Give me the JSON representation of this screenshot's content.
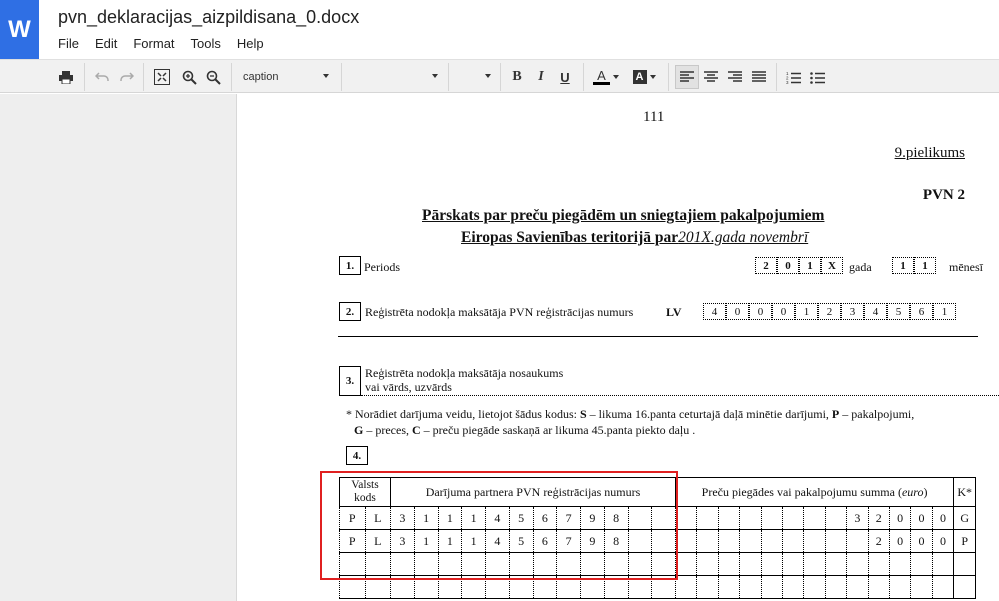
{
  "app": {
    "logo_letter": "W",
    "title": "pvn_deklaracijas_aizpildisana_0.docx",
    "menu": [
      "File",
      "Edit",
      "Format",
      "Tools",
      "Help"
    ]
  },
  "toolbar": {
    "style_value": "caption",
    "font_value": "",
    "size_value": "",
    "bold": "B",
    "italic": "I",
    "underline": "U",
    "text_color": "A",
    "highlight_color": "A"
  },
  "doc": {
    "page_number": "111",
    "annex": "9.pielikums",
    "form_code": "PVN 2",
    "heading_line1": "Pārskats par preču piegādēm un sniegtajiem pakalpojumiem",
    "heading_line2_bold": "Eiropas Savienības teritorijā par",
    "heading_line2_italic": "201X.gada novembrī",
    "s1_num": "1.",
    "s1_label": "Periods",
    "year_digits": [
      "2",
      "0",
      "1",
      "X"
    ],
    "year_suffix": "gada",
    "month_digits": [
      "1",
      "1"
    ],
    "month_suffix": "mēnesī",
    "s2_num": "2.",
    "s2_label": "Reģistrēta nodokļa maksātāja PVN reģistrācijas numurs",
    "country_prefix": "LV",
    "reg_digits": [
      "4",
      "0",
      "0",
      "0",
      "1",
      "2",
      "3",
      "4",
      "5",
      "6",
      "1"
    ],
    "s3_num": "3.",
    "s3_label_line1": "Reģistrēta nodokļa maksātāja nosaukums",
    "s3_label_line2": "vai vārds, uzvārds",
    "note_line1_a": "* Norādiet darījuma veidu, lietojot šādus kodus: ",
    "note_code_s": "S",
    "note_line1_b": " – likuma 16.panta ceturtajā daļā minētie darījumi, ",
    "note_code_p": "P",
    "note_line1_c": " – pakalpojumi,",
    "note_code_g": "G",
    "note_line2_a": " – preces, ",
    "note_code_c": "C",
    "note_line2_b": " – preču piegāde saskaņā ar likuma 45.panta piekto daļu .",
    "s4_num": "4."
  },
  "table": {
    "col_country_line1": "Valsts",
    "col_country_line2": "kods",
    "col_partner": "Darījuma partnera PVN reģistrācijas numurs",
    "col_amount_text": "Preču piegādes vai pakalpojumu summa (",
    "col_amount_unit": "euro",
    "col_amount_close": ")",
    "col_kind": "K*",
    "rows": [
      {
        "country": [
          "P",
          "L"
        ],
        "partner": [
          "3",
          "1",
          "1",
          "1",
          "4",
          "5",
          "6",
          "7",
          "9",
          "8",
          "",
          ""
        ],
        "amount": [
          "",
          "",
          "",
          "",
          "",
          "",
          "",
          "",
          "3",
          "2",
          "0",
          "0",
          "0"
        ],
        "kind": "G"
      },
      {
        "country": [
          "P",
          "L"
        ],
        "partner": [
          "3",
          "1",
          "1",
          "1",
          "4",
          "5",
          "6",
          "7",
          "9",
          "8",
          "",
          ""
        ],
        "amount": [
          "",
          "",
          "",
          "",
          "",
          "",
          "",
          "",
          "",
          "2",
          "0",
          "0",
          "0"
        ],
        "kind": "P"
      },
      {
        "country": [
          "",
          ""
        ],
        "partner": [
          "",
          "",
          "",
          "",
          "",
          "",
          "",
          "",
          "",
          "",
          "",
          ""
        ],
        "amount": [
          "",
          "",
          "",
          "",
          "",
          "",
          "",
          "",
          "",
          "",
          "",
          "",
          ""
        ],
        "kind": ""
      },
      {
        "country": [
          "",
          ""
        ],
        "partner": [
          "",
          "",
          "",
          "",
          "",
          "",
          "",
          "",
          "",
          "",
          "",
          ""
        ],
        "amount": [
          "",
          "",
          "",
          "",
          "",
          "",
          "",
          "",
          "",
          "",
          "",
          "",
          ""
        ],
        "kind": ""
      }
    ]
  },
  "colors": {
    "brand_blue": "#2f6fe4",
    "highlight_red": "#e02020"
  }
}
